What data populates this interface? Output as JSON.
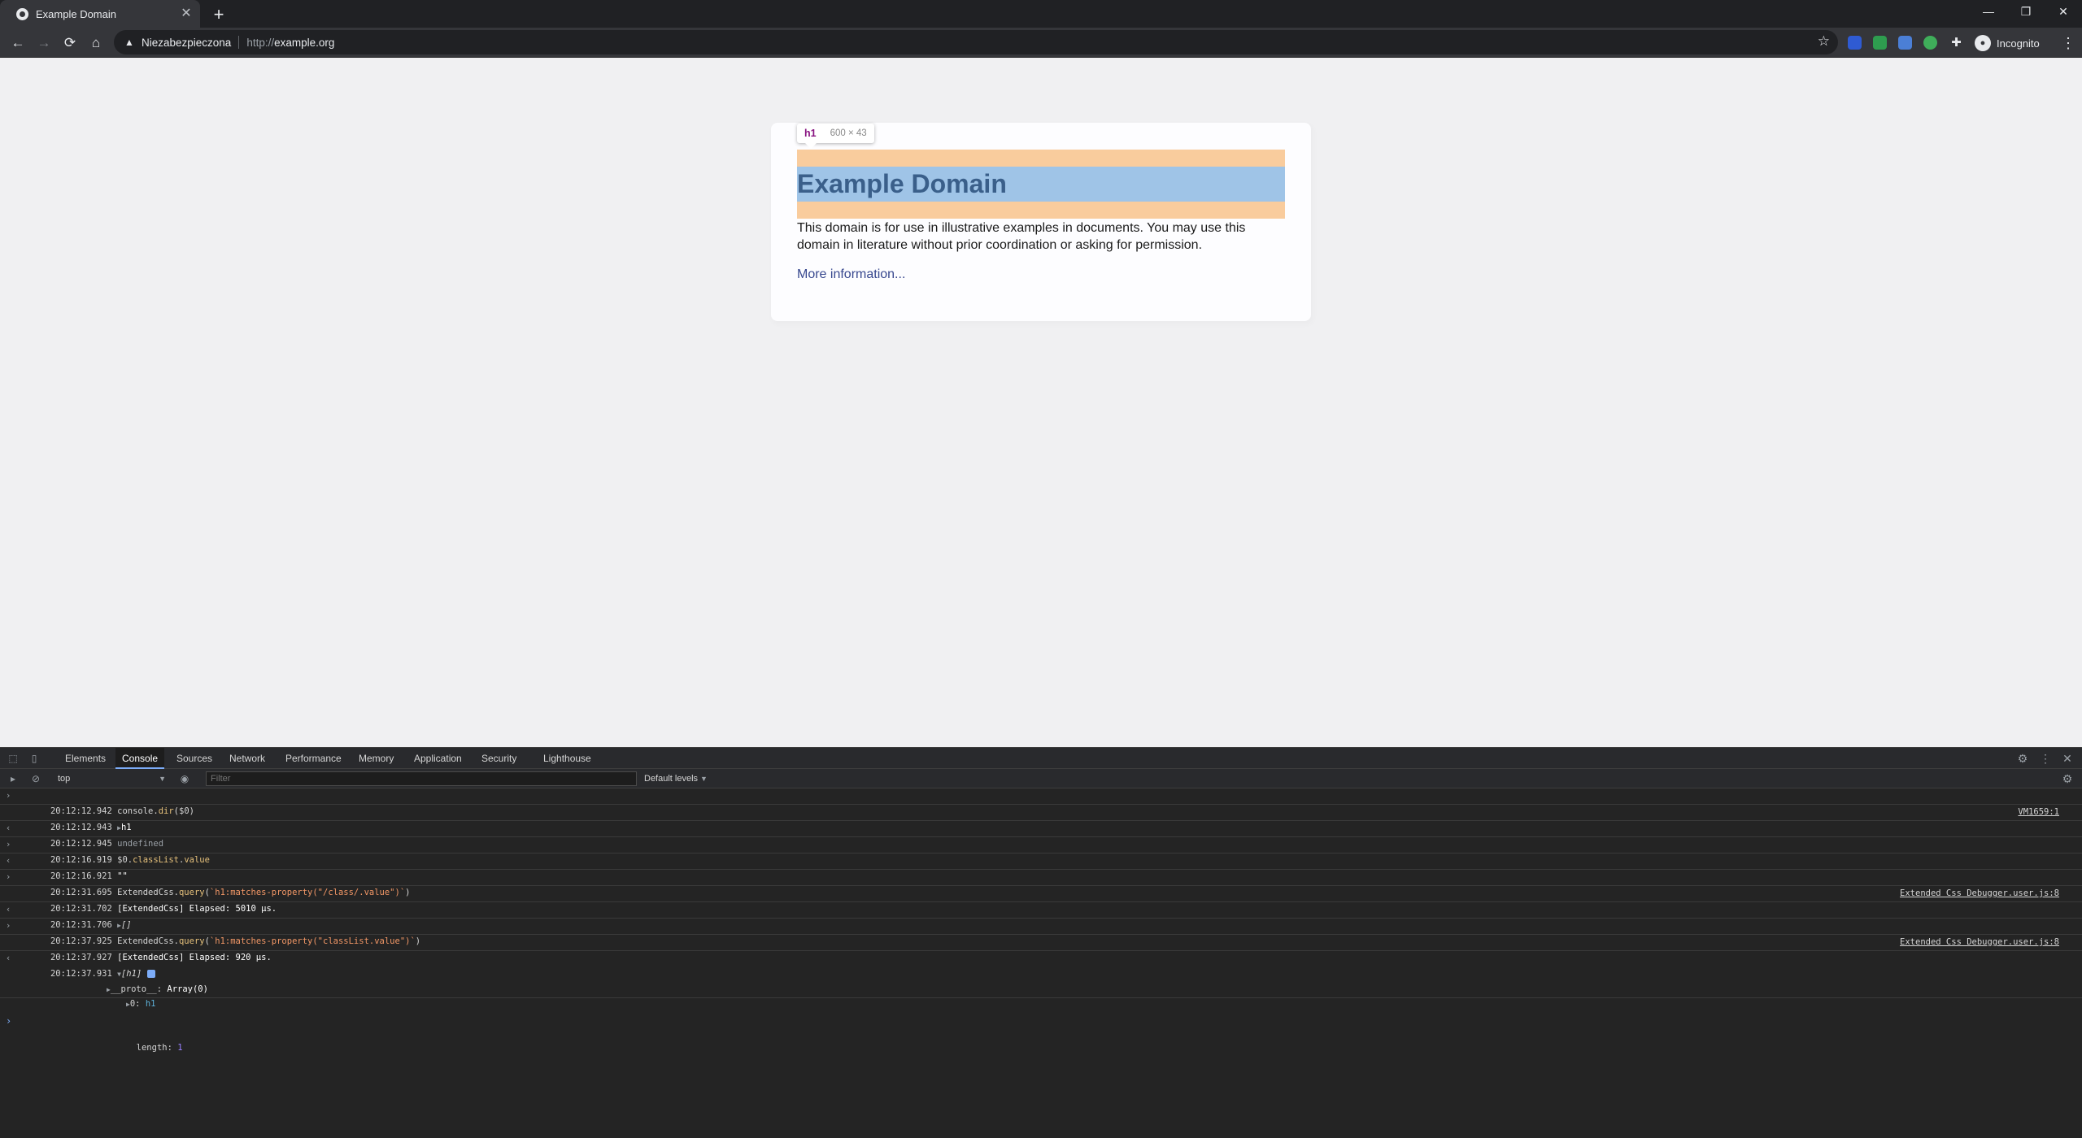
{
  "browser": {
    "tab_title": "Example Domain",
    "new_tab": "+",
    "security_label": "Niezabezpieczona",
    "url_scheme": "http://",
    "url_host": "example.org",
    "profile_label": "Incognito"
  },
  "page": {
    "heading": "Example Domain",
    "paragraph": "This domain is for use in illustrative examples in documents. You may use this domain in literature without prior coordination or asking for permission.",
    "link": "More information...",
    "inspect_tag": "h1",
    "inspect_dims": "600 × 43"
  },
  "devtools": {
    "tabs": [
      "Elements",
      "Console",
      "Sources",
      "Network",
      "Performance",
      "Memory",
      "Application",
      "Security",
      "Lighthouse"
    ],
    "active_tab": "Console",
    "context": "top",
    "filter_placeholder": "Filter",
    "levels": "Default levels",
    "console": {
      "r1_ts": "20:12:12.942",
      "r1_a": "console.",
      "r1_b": "dir",
      "r1_c": "($0)",
      "r2_ts": "20:12:12.943",
      "r2_val": "h1",
      "r2_src": "VM1659:1",
      "r3_ts": "20:12:12.945",
      "r3_val": "undefined",
      "r4_ts": "20:12:16.919",
      "r4_a": "$0.",
      "r4_b": "classList",
      "r4_c": ".",
      "r4_d": "value",
      "r5_ts": "20:12:16.921",
      "r5_val": "\"\"",
      "r6_ts": "20:12:31.695",
      "r6_a": "ExtendedCss.",
      "r6_b": "query",
      "r6_c": "(",
      "r6_d": "`h1:matches-property(\"/class/.value\")`",
      "r6_e": ")",
      "r7_ts": "20:12:31.702",
      "r7_val": "[ExtendedCss] Elapsed: 5010 μs.",
      "r7_src": "Extended Css Debugger.user.js:8",
      "r8_ts": "20:12:31.706",
      "r8_val": "[]",
      "r9_ts": "20:12:37.925",
      "r9_a": "ExtendedCss.",
      "r9_b": "query",
      "r9_c": "(",
      "r9_d": "`h1:matches-property(\"classList.value\")`",
      "r9_e": ")",
      "r10_ts": "20:12:37.927",
      "r10_val": "[ExtendedCss] Elapsed: 920 μs.",
      "r10_src": "Extended Css Debugger.user.js:8",
      "r11_ts": "20:12:37.931",
      "r11_val": "[h1]",
      "r11_item0_key": "0:",
      "r11_item0_val": "h1",
      "r11_len_key": "length:",
      "r11_len_val": "1",
      "r11_proto_key": "__proto__:",
      "r11_proto_val": "Array(0)"
    }
  }
}
